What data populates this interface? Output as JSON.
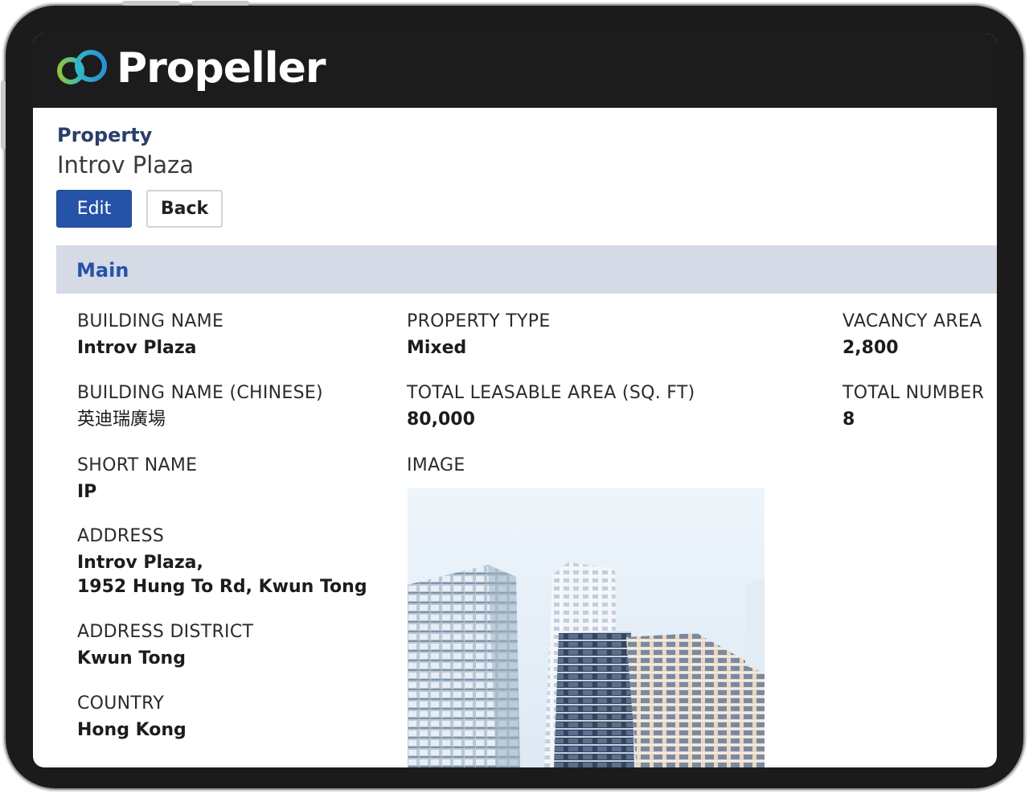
{
  "brand": {
    "name": "Propeller",
    "colors": {
      "ring_left": "#2fb8c6",
      "ring_right": "#8cc63e",
      "header_bg": "#1c1c1c"
    }
  },
  "page": {
    "breadcrumb": "Property",
    "title": "Introv Plaza",
    "buttons": {
      "edit": "Edit",
      "back": "Back"
    },
    "accent": "#2553a8"
  },
  "section": {
    "title": "Main"
  },
  "fields": {
    "building_name": {
      "label": "BUILDING NAME",
      "value": "Introv Plaza"
    },
    "building_name_cn": {
      "label": "BUILDING NAME (CHINESE)",
      "value": "英迪瑞廣場"
    },
    "short_name": {
      "label": "SHORT NAME",
      "value": "IP"
    },
    "address": {
      "label": "ADDRESS",
      "value_line1": "Introv Plaza,",
      "value_line2": "1952 Hung To Rd, Kwun Tong"
    },
    "address_district": {
      "label": "ADDRESS DISTRICT",
      "value": "Kwun Tong"
    },
    "country": {
      "label": "COUNTRY",
      "value": "Hong Kong"
    },
    "property_type": {
      "label": "PROPERTY TYPE",
      "value": "Mixed"
    },
    "total_leasable_area": {
      "label": "TOTAL LEASABLE AREA (SQ. FT)",
      "value": "80,000"
    },
    "image": {
      "label": "IMAGE"
    },
    "vacancy_area": {
      "label": "VACANCY AREA",
      "value": "2,800"
    },
    "total_number": {
      "label": "TOTAL NUMBER",
      "value": "8"
    }
  }
}
